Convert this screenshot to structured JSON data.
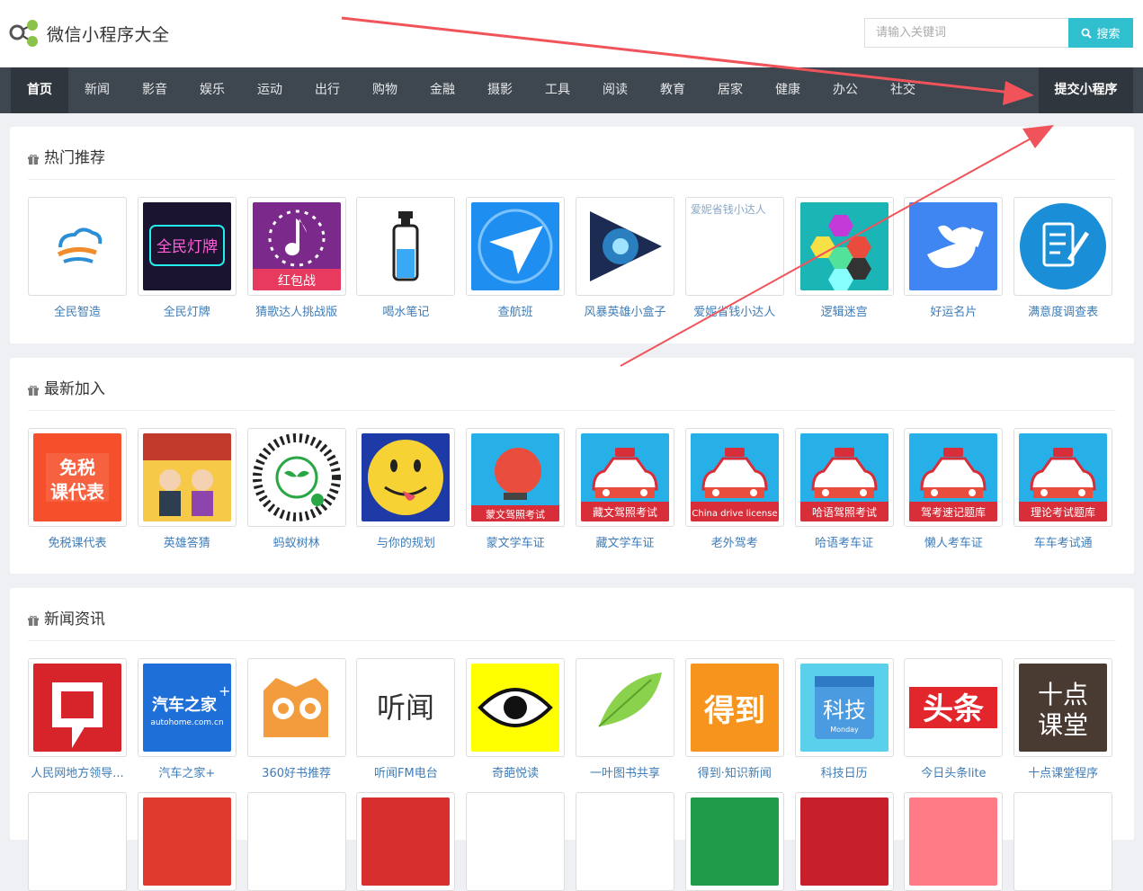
{
  "header": {
    "logo_text": "微信小程序大全",
    "search_placeholder": "请输入关键词",
    "search_button": "搜索"
  },
  "nav": {
    "items": [
      "首页",
      "新闻",
      "影音",
      "娱乐",
      "运动",
      "出行",
      "购物",
      "金融",
      "摄影",
      "工具",
      "阅读",
      "教育",
      "居家",
      "健康",
      "办公",
      "社交"
    ],
    "active_index": 0,
    "submit_label": "提交小程序"
  },
  "sections": [
    {
      "title": "热门推荐",
      "apps": [
        {
          "name": "全民智造",
          "icon": "cloud-logo-icon",
          "color": "#ffffff"
        },
        {
          "name": "全民灯牌",
          "icon": "neon-sign-icon",
          "color": "#1a1430",
          "text": "全民灯牌"
        },
        {
          "name": "猜歌达人挑战版",
          "icon": "music-note-icon",
          "color": "#7b2a8c",
          "text": "红包战"
        },
        {
          "name": "喝水笔记",
          "icon": "water-bottle-icon",
          "color": "#ffffff"
        },
        {
          "name": "查航班",
          "icon": "plane-globe-icon",
          "color": "#1f8ef1"
        },
        {
          "name": "风暴英雄小盒子",
          "icon": "play-vortex-icon",
          "color": "#ffffff"
        },
        {
          "name": "爱妮省钱小达人",
          "icon": "broken-image-icon",
          "color": "#ffffff",
          "alt": "爱妮省钱小达人"
        },
        {
          "name": "逻辑迷宫",
          "icon": "hexagon-puzzle-icon",
          "color": "#1bb5b5"
        },
        {
          "name": "好运名片",
          "icon": "bird-card-icon",
          "color": "#3f86f3"
        },
        {
          "name": "满意度调查表",
          "icon": "survey-pen-icon",
          "color": "#ffffff"
        }
      ]
    },
    {
      "title": "最新加入",
      "apps": [
        {
          "name": "免税课代表",
          "icon": "tax-free-icon",
          "color": "#f5502b",
          "text": "免税\n课代表"
        },
        {
          "name": "英雄答猜",
          "icon": "heroes-cartoon-icon",
          "color": "#f7c948"
        },
        {
          "name": "蚂蚁树林",
          "icon": "qr-sprout-icon",
          "color": "#ffffff"
        },
        {
          "name": "与你的规划",
          "icon": "emoji-face-icon",
          "color": "#1d3aa6"
        },
        {
          "name": "蒙文学车证",
          "icon": "driving-mongolian-icon",
          "color": "#27b0e8",
          "text": "蒙文驾照考试"
        },
        {
          "name": "藏文学车证",
          "icon": "driving-car-icon",
          "color": "#27b0e8",
          "text": "藏文驾照考试"
        },
        {
          "name": "老外驾考",
          "icon": "driving-car-icon",
          "color": "#27b0e8",
          "text": "China drive license"
        },
        {
          "name": "哈语考车证",
          "icon": "driving-car-icon",
          "color": "#27b0e8",
          "text": "哈语驾照考试"
        },
        {
          "name": "懒人考车证",
          "icon": "driving-car-icon",
          "color": "#27b0e8",
          "text": "驾考速记题库"
        },
        {
          "name": "车车考试通",
          "icon": "driving-car-icon",
          "color": "#27b0e8",
          "text": "理论考试题库"
        }
      ]
    },
    {
      "title": "新闻资讯",
      "apps": [
        {
          "name": "人民网地方领导...",
          "icon": "people-daily-icon",
          "color": "#d7232a"
        },
        {
          "name": "汽车之家+",
          "icon": "autohome-icon",
          "color": "#1f6fd8",
          "text": "汽车之家"
        },
        {
          "name": "360好书推荐",
          "icon": "owl-book-icon",
          "color": "#ffffff"
        },
        {
          "name": "听闻FM电台",
          "icon": "tingwen-icon",
          "color": "#ffffff",
          "text": "听闻"
        },
        {
          "name": "奇葩悦读",
          "icon": "eye-icon",
          "color": "#ffff00"
        },
        {
          "name": "一叶图书共享",
          "icon": "leaf-icon",
          "color": "#9cd255"
        },
        {
          "name": "得到·知识新闻",
          "icon": "dedao-icon",
          "color": "#f7941d",
          "text": "得到"
        },
        {
          "name": "科技日历",
          "icon": "calendar-tech-icon",
          "color": "#5ad0ec",
          "text": "科技"
        },
        {
          "name": "今日头条lite",
          "icon": "toutiao-icon",
          "color": "#ffffff",
          "text": "头条"
        },
        {
          "name": "十点课堂程序",
          "icon": "ten-class-icon",
          "color": "#4a3b32",
          "text": "十点\n课堂"
        }
      ]
    }
  ]
}
